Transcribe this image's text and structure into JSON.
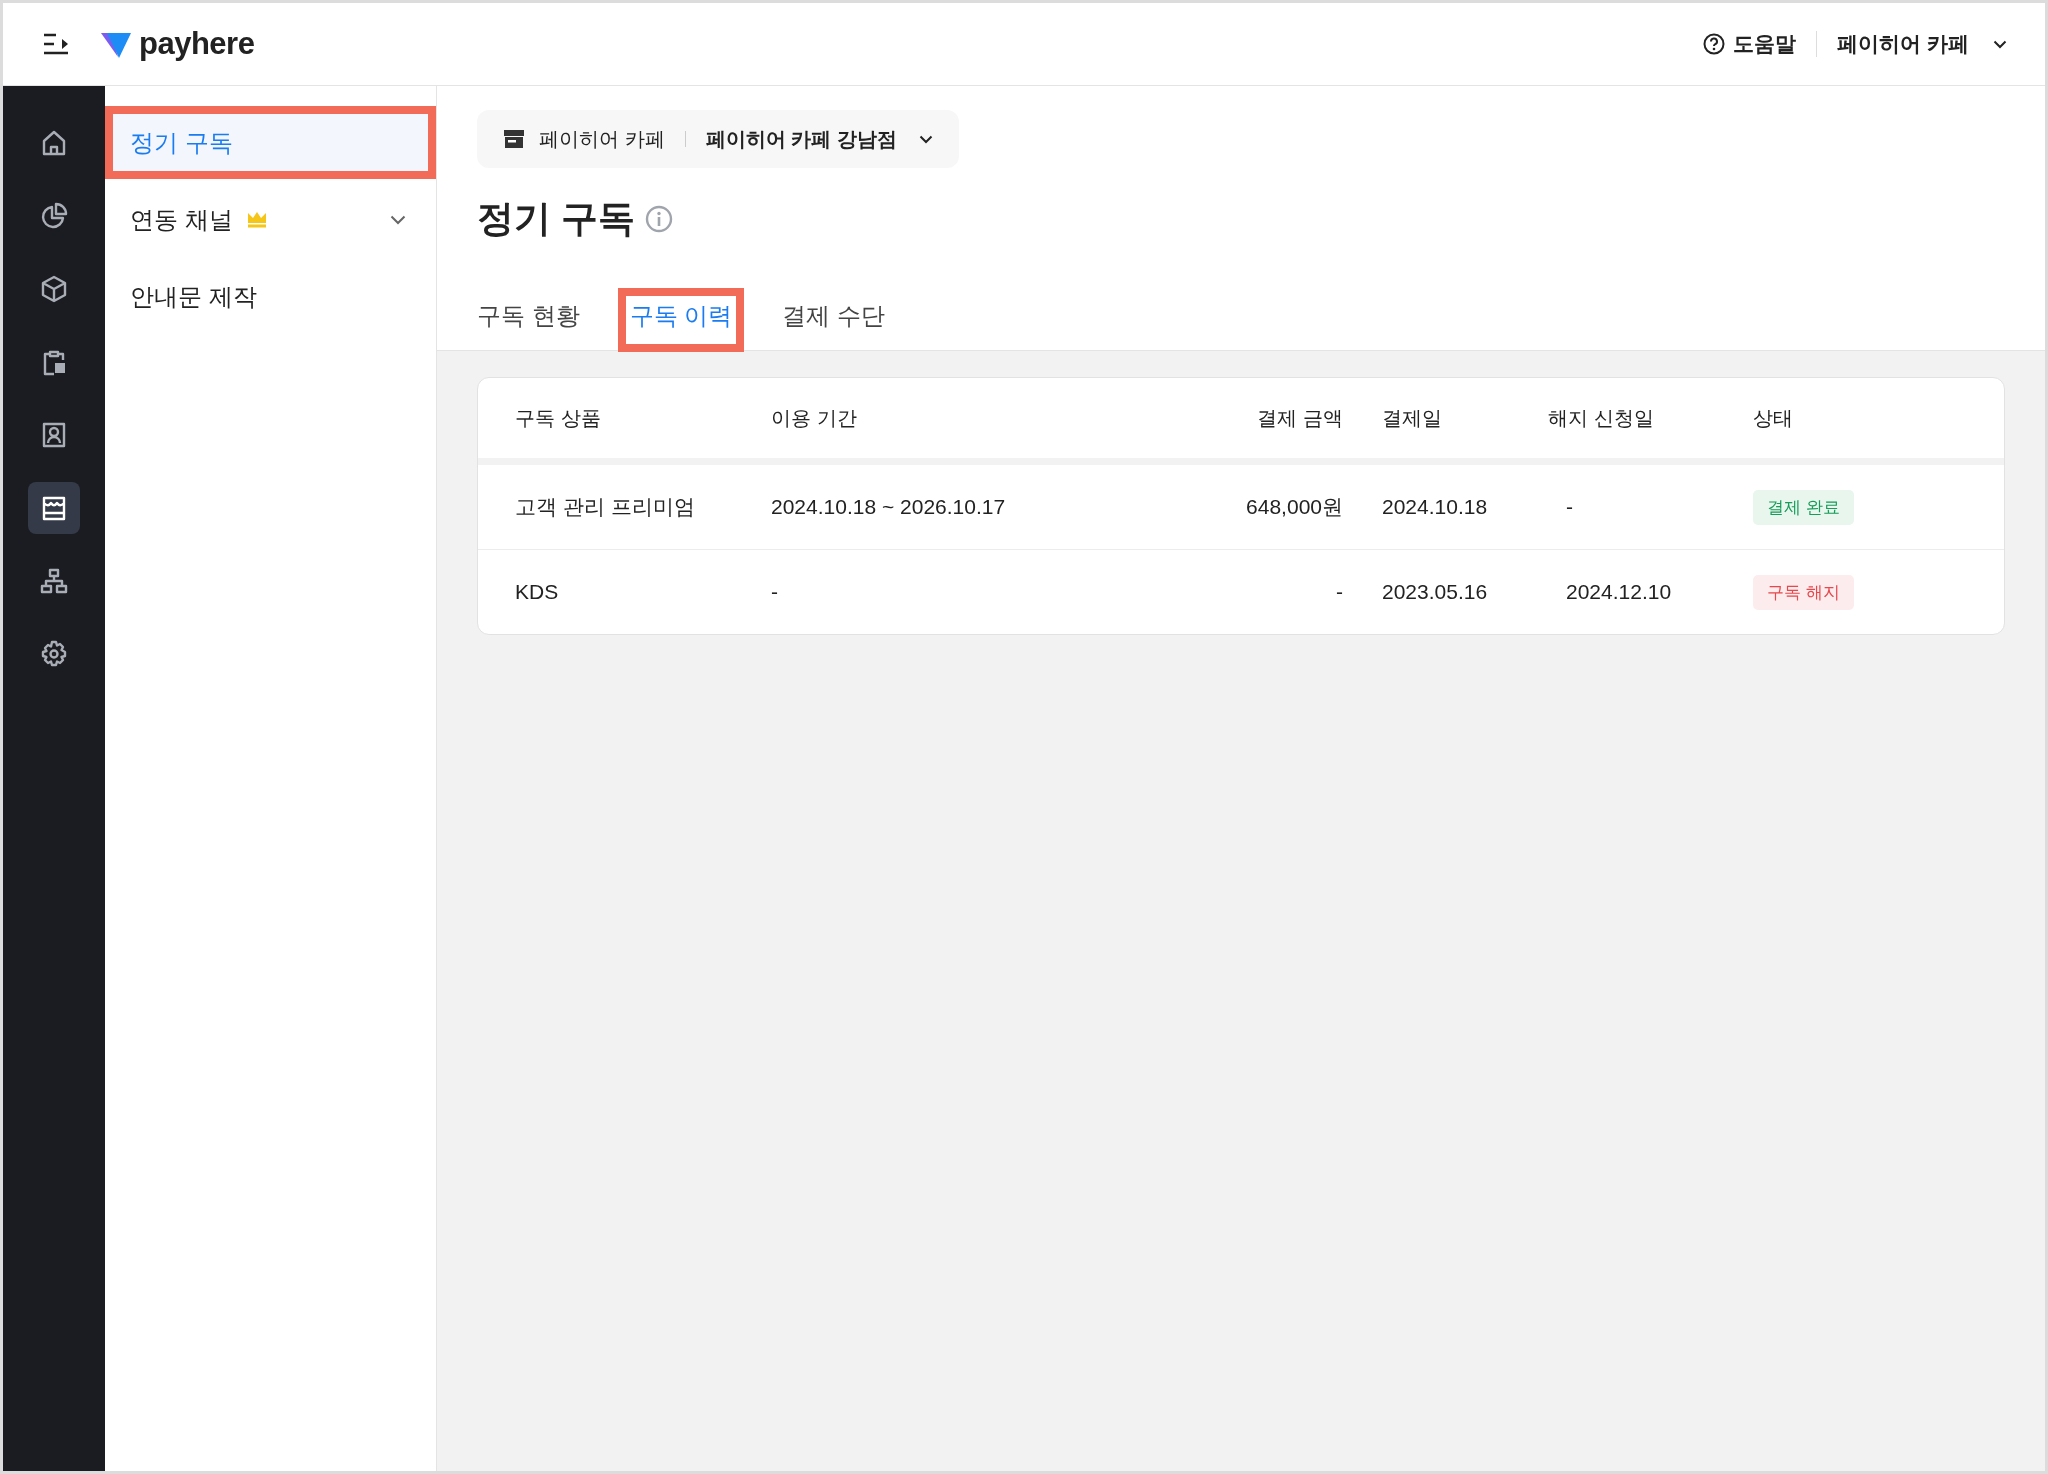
{
  "topbar": {
    "logo": "payhere",
    "help": "도움말",
    "account": "페이히어 카페"
  },
  "rail": [
    {
      "kind": "home",
      "selected": false
    },
    {
      "kind": "chart",
      "selected": false
    },
    {
      "kind": "cube",
      "selected": false
    },
    {
      "kind": "clipboard",
      "selected": false
    },
    {
      "kind": "contact",
      "selected": false
    },
    {
      "kind": "store",
      "selected": true
    },
    {
      "kind": "sitemap",
      "selected": false
    },
    {
      "kind": "gear",
      "selected": false
    }
  ],
  "submenu": [
    {
      "label": "정기 구독",
      "selected": true,
      "annotated": true,
      "premium": false,
      "expandable": false
    },
    {
      "label": "연동 채널",
      "selected": false,
      "annotated": false,
      "premium": true,
      "expandable": true
    },
    {
      "label": "안내문 제작",
      "selected": false,
      "annotated": false,
      "premium": false,
      "expandable": false
    }
  ],
  "store_picker": {
    "brand": "페이히어 카페",
    "store": "페이히어 카페 강남점"
  },
  "page_title": "정기 구독",
  "tabs": [
    {
      "label": "구독 현황",
      "selected": false,
      "annotated": false
    },
    {
      "label": "구독 이력",
      "selected": true,
      "annotated": true
    },
    {
      "label": "결제 수단",
      "selected": false,
      "annotated": false
    }
  ],
  "table": {
    "columns": [
      "구독 상품",
      "이용 기간",
      "결제 금액",
      "결제일",
      "해지 신청일",
      "상태"
    ],
    "rows": [
      {
        "cells": [
          "고객 관리 프리미엄",
          "2024.10.18 ~ 2026.10.17",
          "648,000원",
          "2024.10.18",
          "-"
        ],
        "status": {
          "label": "결제 완료",
          "kind": "success"
        }
      },
      {
        "cells": [
          "KDS",
          "-",
          "-",
          "2023.05.16",
          "2024.12.10"
        ],
        "status": {
          "label": "구독 해지",
          "kind": "danger"
        }
      }
    ]
  }
}
